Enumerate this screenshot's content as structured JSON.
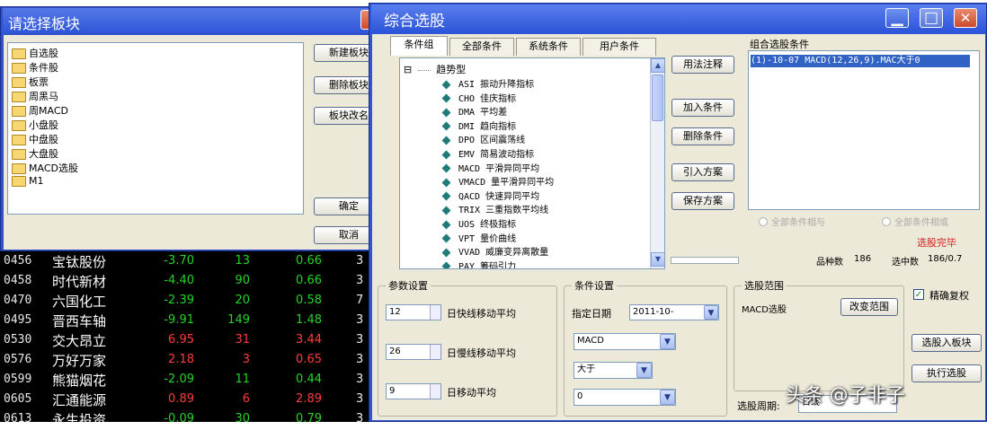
{
  "stock_table": {
    "rows": [
      {
        "code": "0456",
        "name": "宝钛股份",
        "change": "-3.70",
        "volume": "13",
        "pct": "0.66",
        "tail": "3",
        "dir": "dn"
      },
      {
        "code": "0458",
        "name": "时代新材",
        "change": "-4.40",
        "volume": "90",
        "pct": "0.66",
        "tail": "3",
        "dir": "dn"
      },
      {
        "code": "0470",
        "name": "六国化工",
        "change": "-2.39",
        "volume": "20",
        "pct": "0.58",
        "tail": "7",
        "dir": "dn"
      },
      {
        "code": "0495",
        "name": "晋西车轴",
        "change": "-9.91",
        "volume": "149",
        "pct": "1.48",
        "tail": "3",
        "dir": "dn"
      },
      {
        "code": "0530",
        "name": "交大昂立",
        "change": "6.95",
        "volume": "31",
        "pct": "3.44",
        "tail": "3",
        "dir": "up"
      },
      {
        "code": "0576",
        "name": "万好万家",
        "change": "2.18",
        "volume": "3",
        "pct": "0.65",
        "tail": "3",
        "dir": "up"
      },
      {
        "code": "0599",
        "name": "熊猫烟花",
        "change": "-2.09",
        "volume": "11",
        "pct": "0.44",
        "tail": "3",
        "dir": "dn"
      },
      {
        "code": "0605",
        "name": "汇通能源",
        "change": "0.89",
        "volume": "6",
        "pct": "2.89",
        "tail": "3",
        "dir": "up"
      },
      {
        "code": "0613",
        "name": "永生投资",
        "change": "-0.09",
        "volume": "30",
        "pct": "0.79",
        "tail": "3",
        "dir": "dn"
      }
    ]
  },
  "block_dialog": {
    "title": "请选择板块",
    "close_glyph": "✕",
    "blocks": [
      "自选股",
      "条件股",
      "板票",
      "周黑马",
      "周MACD",
      "小盘股",
      "中盘股",
      "大盘股",
      "MACD选股",
      "M1"
    ],
    "buttons": {
      "new": "新建板块",
      "delete": "删除板块",
      "rename": "板块改名",
      "ok": "确定",
      "cancel": "取消"
    }
  },
  "picker": {
    "title": "综合选股",
    "window_glyphs": {
      "minimize": "▁",
      "maximize": "□",
      "close": "✕"
    },
    "tabs": [
      "条件组",
      "全部条件",
      "系统条件",
      "用户条件"
    ],
    "tree": {
      "expand_glyph": "⊟",
      "root": "趋势型",
      "items": [
        "ASI 振动升降指标",
        "CHO 佳庆指标",
        "DMA 平均差",
        "DMI 趋向指标",
        "DPO 区间震荡线",
        "EMV 简易波动指标",
        "MACD 平滑异同平均",
        "VMACD 量平滑异同平均",
        "QACD 快速异同平均",
        "TRIX 三重指数平均线",
        "UOS 终极指标",
        "VPT 量价曲线",
        "VVAD 威廉变异离散量",
        "PAY 筹码引力"
      ]
    },
    "scroll_glyphs": {
      "up": "▲",
      "down": "▼"
    },
    "buttons": {
      "formula": "用法注释",
      "add": "加入条件",
      "delete": "删除条件",
      "import": "引入方案",
      "save": "保存方案"
    },
    "combo": {
      "label": "组合选股条件",
      "items": [
        "(1)-10-07 MACD(12,26,9).MAC大于0"
      ],
      "radio_and": "全部条件相与",
      "radio_or": "全部条件相或"
    },
    "status": {
      "done": "选股完毕",
      "count_label": "品种数",
      "count": "186",
      "selected_label": "选中数",
      "selected": "186/0.7"
    },
    "params": {
      "label": "参数设置",
      "rows": [
        {
          "value": "12",
          "text": "日快线移动平均"
        },
        {
          "value": "26",
          "text": "日慢线移动平均"
        },
        {
          "value": "9",
          "text": "日移动平均"
        }
      ]
    },
    "conditions": {
      "label": "条件设置",
      "date_label": "指定日期",
      "date_value": "2011-10-",
      "indicator": "MACD",
      "operator": "大于",
      "threshold": "0",
      "dropdown_glyph": "▼"
    },
    "scope": {
      "label": "选股范围",
      "value": "MACD选股",
      "change_button": "改变范围"
    },
    "precise_restore": {
      "label": "精确复权",
      "checked_glyph": "✓"
    },
    "period_label": "选股周期:",
    "period_value": "日线",
    "buttons_bottom": {
      "to_block": "选股入板块",
      "execute": "执行选股"
    }
  },
  "watermark": "头条 @子非子"
}
